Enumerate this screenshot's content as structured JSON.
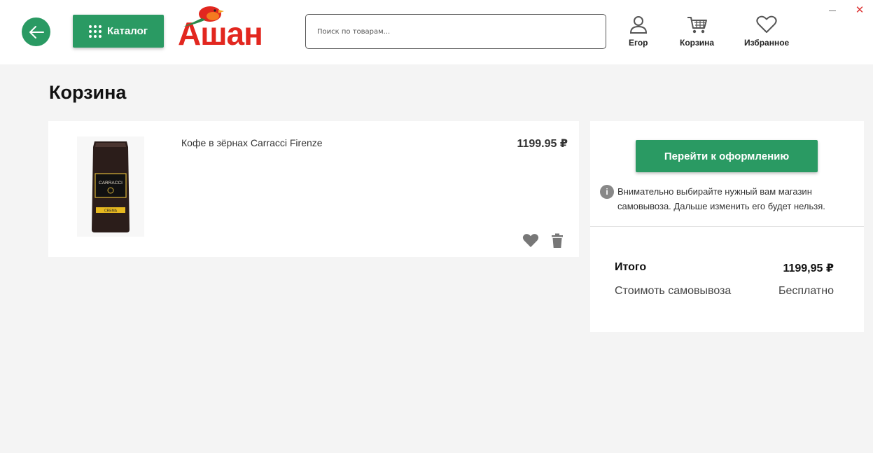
{
  "header": {
    "catalog_label": "Каталог",
    "logo_text": "Ашан",
    "search_placeholder": "Поиск по товарам...",
    "user_label": "Егор",
    "cart_label": "Корзина",
    "favorites_label": "Избранное",
    "close_glyph": "✕"
  },
  "page": {
    "title": "Корзина"
  },
  "cart": {
    "items": [
      {
        "name": "Кофе в зёрнах Carracci Firenze",
        "price": "1199.95 ₽",
        "image_brand": "CARRACCI",
        "image_label": "CREMA"
      }
    ]
  },
  "summary": {
    "checkout_label": "Перейти к оформлению",
    "info_icon": "i",
    "notice": "Внимательно выбирайте нужный вам магазин самовывоза. Дальше изменить его будет нельзя.",
    "total_label": "Итого",
    "total_value": "1199,95 ₽",
    "pickup_label": "Стоимоть самовывоза",
    "pickup_value": "Бесплатно"
  },
  "colors": {
    "accent": "#2a9a63",
    "logo_red": "#e2271f",
    "background": "#f4f4f4"
  },
  "icons": [
    "arrow-left-icon",
    "grid-dots-icon",
    "user-icon",
    "cart-icon",
    "heart-outline-icon",
    "heart-icon",
    "trash-icon",
    "info-icon",
    "minimize-icon",
    "close-icon"
  ]
}
